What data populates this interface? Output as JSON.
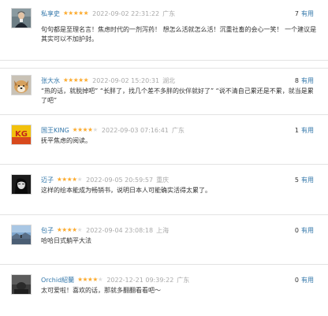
{
  "reviews": [
    {
      "user": "私享史",
      "rating": 5,
      "date": "2022-09-02 22:31:22",
      "location": "广东",
      "useful_count": "7",
      "useful_label": "有用",
      "content": "句句都是至理名言！焦虑时代的一剂泻药！ 想怎么活就怎么活！沉重社畜的会心一笑！ 一个建议是其实可以不加护封。",
      "avatar": "portrait-avatar"
    },
    {
      "user": "张大水",
      "rating": 5,
      "date": "2022-09-02 15:20:31",
      "location": "湖北",
      "useful_count": "8",
      "useful_label": "有用",
      "content": "“热的话，就脱掉吧” “长胖了，找几个差不多胖的伙伴就好了” “说不清自己累还是不累，就当是累了吧”",
      "avatar": "dog-avatar"
    },
    {
      "user": "国王KING",
      "rating": 4,
      "date": "2022-09-03 07:16:41",
      "location": "广东",
      "useful_count": "1",
      "useful_label": "有用",
      "content": "抚平焦虑的阅读。",
      "avatar": "king-logo-avatar"
    },
    {
      "user": "迈子",
      "rating": 4,
      "date": "2022-09-05 20:59:57",
      "location": "重庆",
      "useful_count": "5",
      "useful_label": "有用",
      "content": "这样的绘本能成为畅销书，说明日本人可能确实活得太累了。",
      "avatar": "bw-face-avatar"
    },
    {
      "user": "包子",
      "rating": 4,
      "date": "2022-09-04 23:08:18",
      "location": "上海",
      "useful_count": "0",
      "useful_label": "有用",
      "content": "哈哈日式躺平大法",
      "avatar": "landscape-avatar"
    },
    {
      "user": "Orchid紹蘭",
      "rating": 4,
      "date": "2022-12-21 09:39:22",
      "location": "广东",
      "useful_count": "0",
      "useful_label": "有用",
      "content": "太可爱啦！喜欢的话，那就多翻翻看看吧～",
      "avatar": "dark-photo-avatar"
    }
  ],
  "colors": {
    "link": "#3377aa",
    "star": "#ffac2d",
    "meta": "#aaaaaa"
  }
}
